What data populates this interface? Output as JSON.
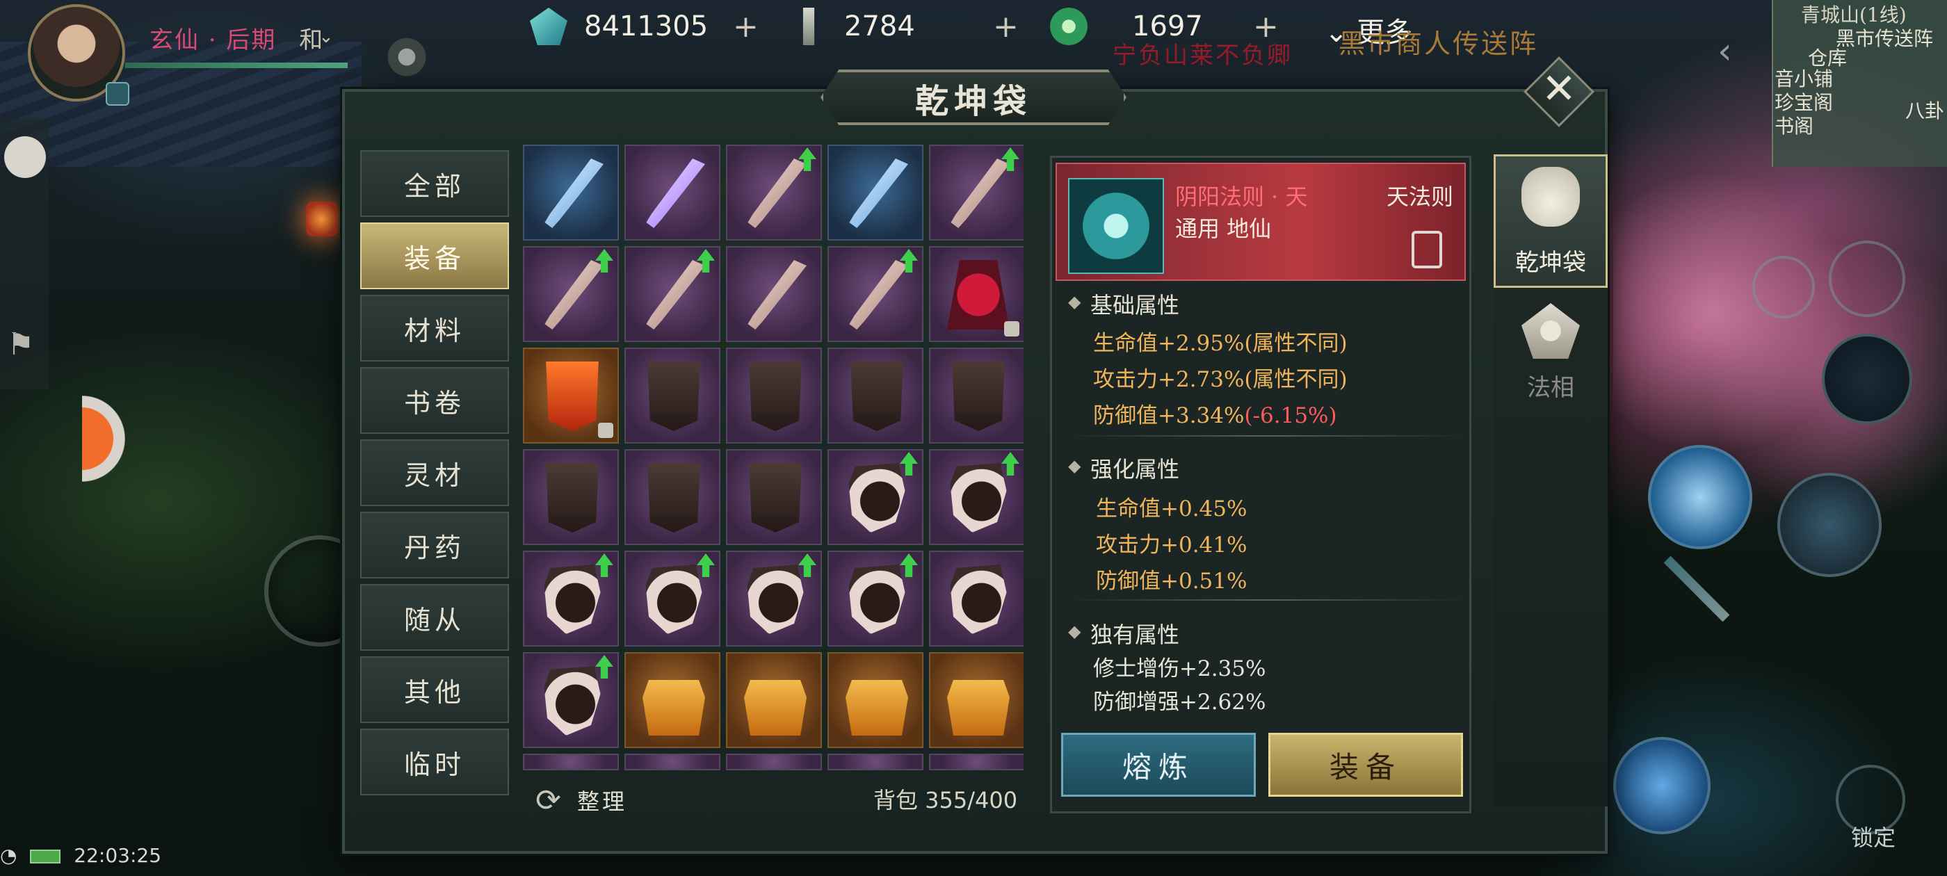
{
  "hud": {
    "realm": "玄仙 · 后期",
    "realm_suffix": "和",
    "currencies": [
      {
        "icon": "spirit-stone-icon",
        "value": "8411305"
      },
      {
        "icon": "jade-slip-icon",
        "value": "2784"
      },
      {
        "icon": "jade-coin-icon",
        "value": "1697"
      }
    ],
    "plus": "+",
    "more": "更多",
    "banner": "宁负山莱不负卿",
    "teleport": "黑市商人传送阵",
    "time": "22:03:25"
  },
  "minimap": {
    "title": "青城山(1线)",
    "labels": [
      "黑市传送阵",
      "仓库",
      "音小铺",
      "珍宝阁",
      "书阁",
      "八卦"
    ]
  },
  "panel": {
    "title": "乾坤袋",
    "close": "✕",
    "categories": [
      "全部",
      "装备",
      "材料",
      "书卷",
      "灵材",
      "丹药",
      "随从",
      "其他",
      "临时"
    ],
    "active_category": "装备",
    "sort_label": "整理",
    "bag_count": "背包 355/400"
  },
  "grid": [
    [
      "sword-blue",
      "sword-violet",
      "sword-up",
      "sword-blue",
      "sword-up"
    ],
    [
      "sword-up",
      "sword-up",
      "sword",
      "sword-up",
      "redcape-lock"
    ],
    [
      "banner-red-lock",
      "banner",
      "banner",
      "banner",
      "banner"
    ],
    [
      "banner",
      "banner",
      "banner",
      "shield-up",
      "shield-up"
    ],
    [
      "shield-up",
      "shield-up",
      "shield-up",
      "shield-up",
      "shield"
    ],
    [
      "shield-up",
      "chest",
      "chest",
      "chest",
      "chest"
    ],
    [
      "partial",
      "partial",
      "partial",
      "partial",
      "partial"
    ]
  ],
  "detail": {
    "name": "阴阳法则 · 天",
    "rank": "天法则",
    "requirement": "通用 地仙",
    "base_title": "基础属性",
    "base": [
      {
        "text": "生命值+2.95%(属性不同)"
      },
      {
        "text": "攻击力+2.73%(属性不同)"
      },
      {
        "text": "防御值+3.34%",
        "neg": "(-6.15%)"
      }
    ],
    "enhance_title": "强化属性",
    "enhance": [
      "生命值+0.45%",
      "攻击力+0.41%",
      "防御值+0.51%"
    ],
    "unique_title": "独有属性",
    "unique": [
      "修士增伤+2.35%",
      "防御增强+2.62%"
    ],
    "smelt": "熔炼",
    "equip": "装备"
  },
  "tabs": {
    "bag": "乾坤袋",
    "fa": "法相"
  },
  "lock_label": "锁定",
  "colors": {
    "accent_gold": "#c9b46d",
    "attr_gold": "#f0b55a",
    "negative": "#ff5a5a",
    "item_name": "#ff6e74",
    "smelt_blue": "#2d6b7f"
  }
}
